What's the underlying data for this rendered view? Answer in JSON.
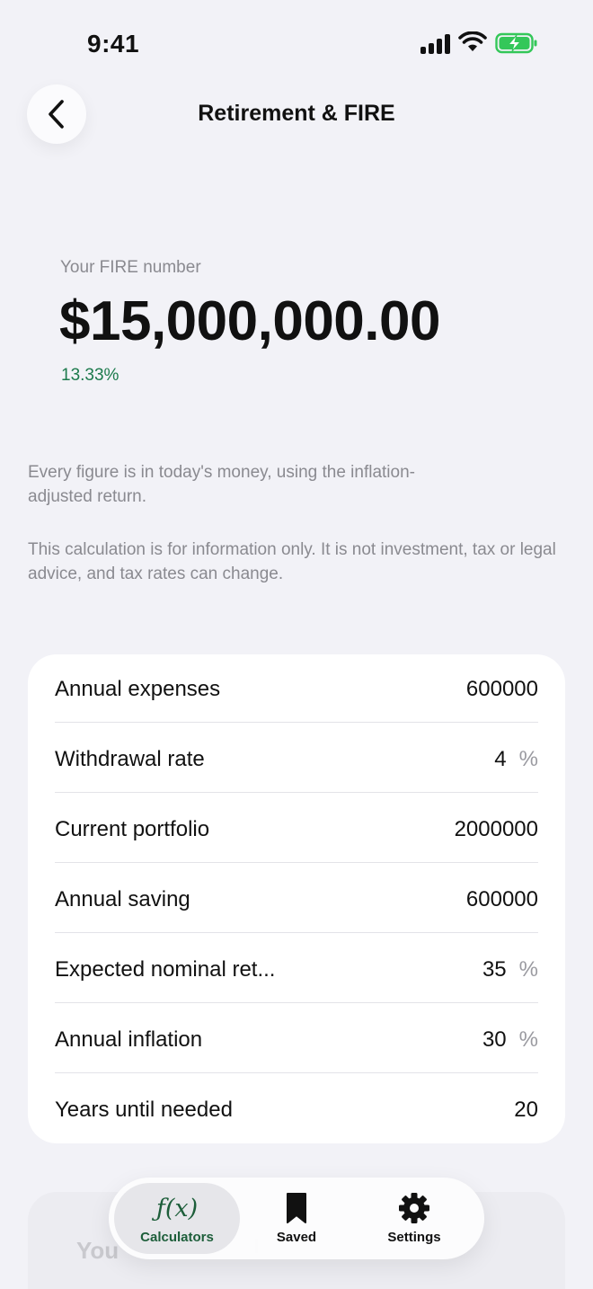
{
  "status_bar": {
    "time": "9:41"
  },
  "header": {
    "title": "Retirement & FIRE"
  },
  "hero": {
    "label": "Your FIRE number",
    "value": "$15,000,000.00",
    "rate": "13.33%"
  },
  "notes": [
    "Every figure is in today's money, using the inflation-adjusted return.",
    "This calculation is for information only. It is not investment, tax or legal advice, and tax rates can change."
  ],
  "inputs": [
    {
      "label": "Annual expenses",
      "value": "600000",
      "unit": ""
    },
    {
      "label": "Withdrawal rate",
      "value": "4",
      "unit": "%"
    },
    {
      "label": "Current portfolio",
      "value": "2000000",
      "unit": ""
    },
    {
      "label": "Annual saving",
      "value": "600000",
      "unit": ""
    },
    {
      "label": "Expected nominal ret...",
      "value": "35",
      "unit": "%"
    },
    {
      "label": "Annual inflation",
      "value": "30",
      "unit": "%"
    },
    {
      "label": "Years until needed",
      "value": "20",
      "unit": ""
    }
  ],
  "ghost_card": {
    "text": "You"
  },
  "tab_bar": {
    "tabs": [
      {
        "label": "Calculators",
        "icon": "fx-icon",
        "active": true
      },
      {
        "label": "Saved",
        "icon": "bookmark-icon",
        "active": false
      },
      {
        "label": "Settings",
        "icon": "gear-icon",
        "active": false
      }
    ]
  },
  "colors": {
    "accent": "#1d5e3a",
    "positive": "#1c7a4c",
    "background": "#f2f2f7"
  }
}
